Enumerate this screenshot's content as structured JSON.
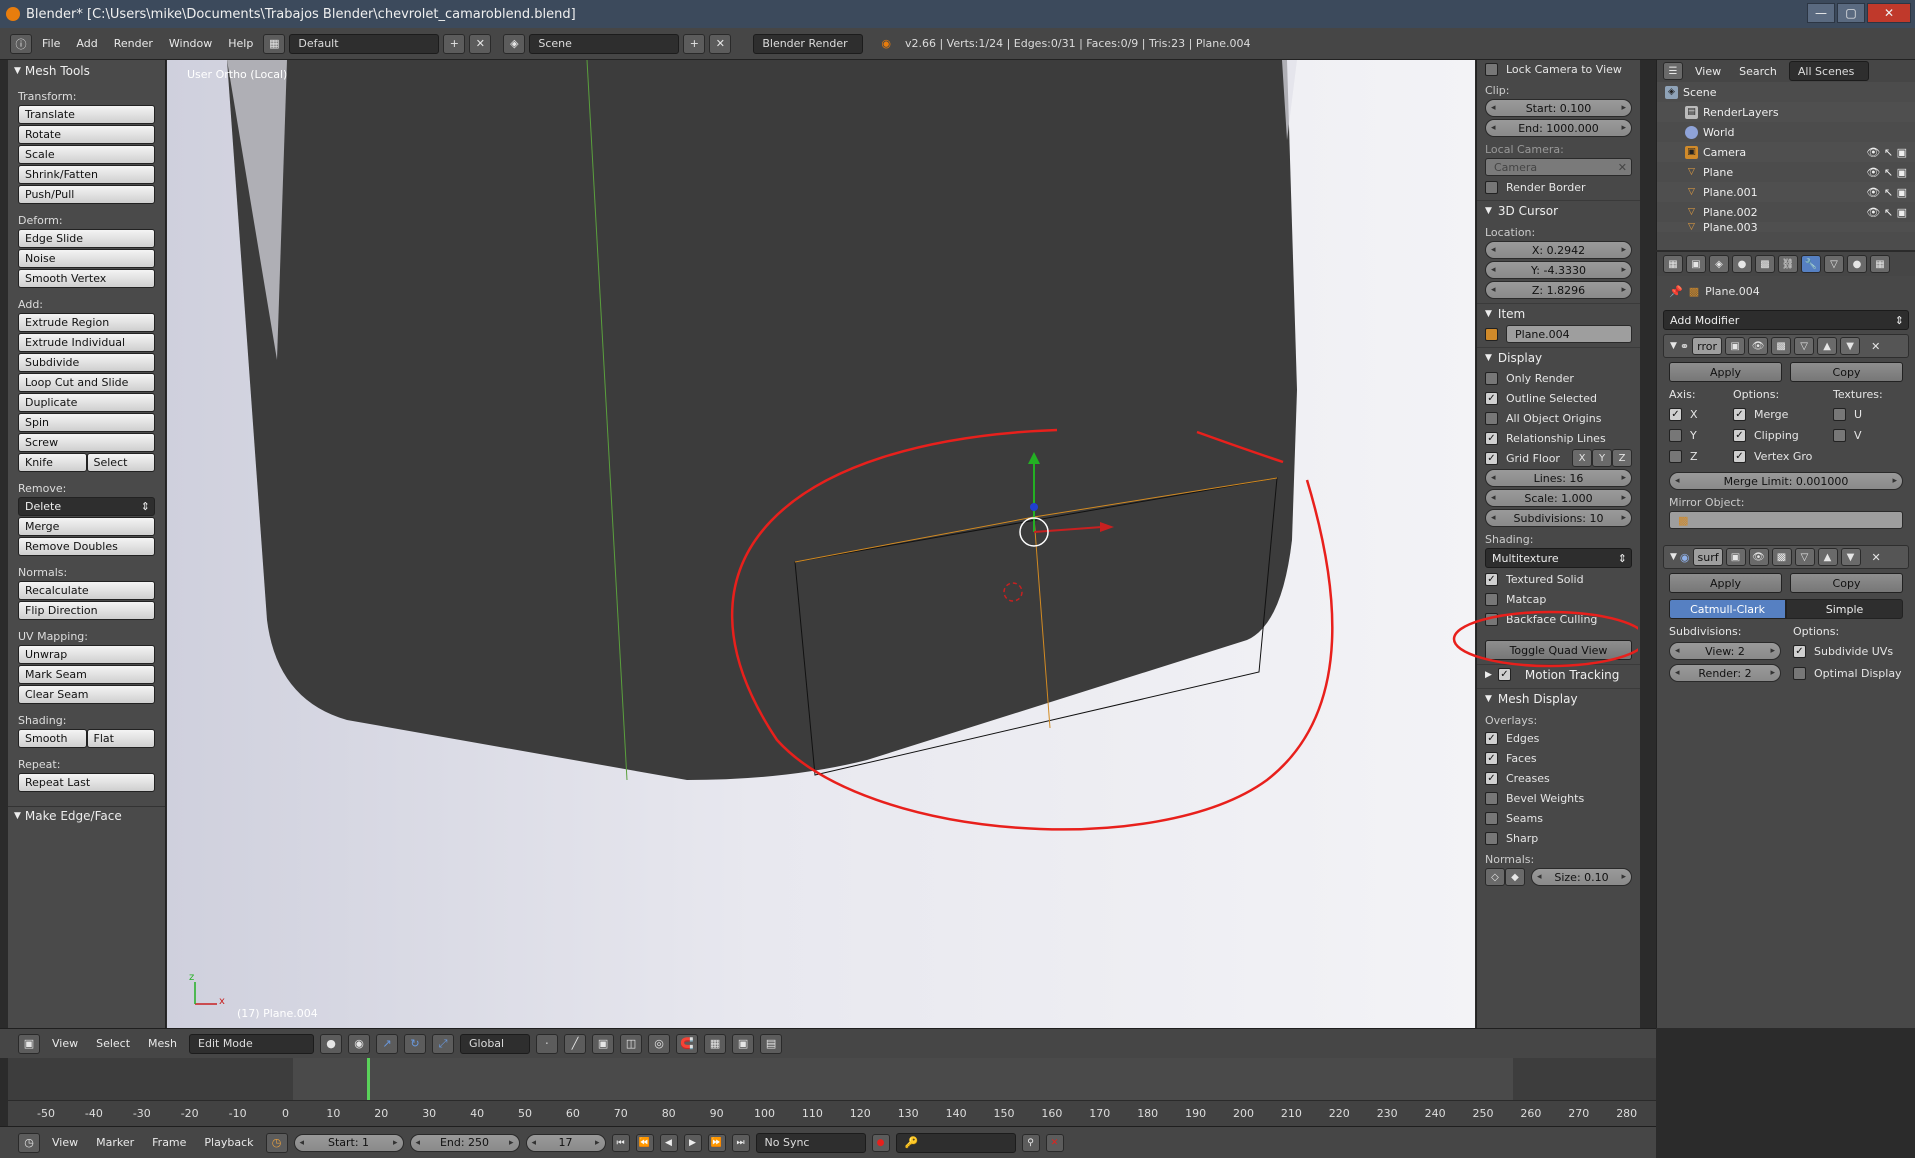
{
  "title": "Blender* [C:\\Users\\mike\\Documents\\Trabajos Blender\\chevrolet_camaroblend.blend]",
  "menus": [
    "File",
    "Add",
    "Render",
    "Window",
    "Help"
  ],
  "layout": "Default",
  "scene": "Scene",
  "engine": "Blender Render",
  "stats": "v2.66 | Verts:1/24 | Edges:0/31 | Faces:0/9 | Tris:23 | Plane.004",
  "tool_shelf": {
    "title": "Mesh Tools",
    "transform_label": "Transform:",
    "transform": [
      "Translate",
      "Rotate",
      "Scale",
      "Shrink/Fatten",
      "Push/Pull"
    ],
    "deform_label": "Deform:",
    "deform": [
      "Edge Slide",
      "Noise",
      "Smooth Vertex"
    ],
    "add_label": "Add:",
    "add": [
      "Extrude Region",
      "Extrude Individual",
      "Subdivide",
      "Loop Cut and Slide",
      "Duplicate",
      "Spin",
      "Screw"
    ],
    "knife": "Knife",
    "select": "Select",
    "remove_label": "Remove:",
    "delete": "Delete",
    "merge": "Merge",
    "remove_doubles": "Remove Doubles",
    "normals_label": "Normals:",
    "recalculate": "Recalculate",
    "flip": "Flip Direction",
    "uv_label": "UV Mapping:",
    "unwrap": "Unwrap",
    "mark_seam": "Mark Seam",
    "clear_seam": "Clear Seam",
    "shading_label": "Shading:",
    "smooth": "Smooth",
    "flat": "Flat",
    "repeat_label": "Repeat:",
    "repeat_last": "Repeat Last",
    "make_edge": "Make Edge/Face"
  },
  "viewport": {
    "view_label": "User Ortho (Local)",
    "object_label": "(17) Plane.004",
    "axis_x": "x",
    "axis_z": "z"
  },
  "nprops": {
    "lock_camera": "Lock Camera to View",
    "clip_label": "Clip:",
    "clip_start": "Start: 0.100",
    "clip_end": "End: 1000.000",
    "local_camera": "Local Camera:",
    "camera": "Camera",
    "render_border": "Render Border",
    "cursor_title": "3D Cursor",
    "location_label": "Location:",
    "cx": "X: 0.2942",
    "cy": "Y: -4.3330",
    "cz": "Z: 1.8296",
    "item_title": "Item",
    "item_name": "Plane.004",
    "display_title": "Display",
    "only_render": "Only Render",
    "outline_selected": "Outline Selected",
    "all_origins": "All Object Origins",
    "relationship": "Relationship Lines",
    "grid_floor": "Grid Floor",
    "gx": "X",
    "gy": "Y",
    "gz": "Z",
    "lines": "Lines: 16",
    "scale": "Scale: 1.000",
    "subdivisions": "Subdivisions: 10",
    "shading_label": "Shading:",
    "shading": "Multitexture",
    "textured_solid": "Textured Solid",
    "matcap": "Matcap",
    "backface": "Backface Culling",
    "toggle_quad": "Toggle Quad View",
    "motion_tracking": "Motion Tracking",
    "mesh_display": "Mesh Display",
    "overlays": "Overlays:",
    "edges": "Edges",
    "faces": "Faces",
    "creases": "Creases",
    "bevel": "Bevel Weights",
    "seams": "Seams",
    "sharp": "Sharp",
    "normals_label": "Normals:",
    "size": "Size: 0.10"
  },
  "outliner": {
    "view": "View",
    "search": "Search",
    "all_scenes": "All Scenes",
    "rows": [
      "Scene",
      "RenderLayers",
      "World",
      "Camera",
      "Plane",
      "Plane.001",
      "Plane.002",
      "Plane.003"
    ]
  },
  "props": {
    "object": "Plane.004",
    "add_modifier": "Add Modifier",
    "mirror_name": "rror",
    "apply": "Apply",
    "copy": "Copy",
    "axis": "Axis:",
    "options": "Options:",
    "textures": "Textures:",
    "x": "X",
    "y": "Y",
    "z": "Z",
    "merge": "Merge",
    "clipping": "Clipping",
    "vertex_gro": "Vertex Gro",
    "u": "U",
    "v": "V",
    "merge_limit": "Merge Limit: 0.001000",
    "mirror_object": "Mirror Object:",
    "surf_name": "surf",
    "catmull": "Catmull-Clark",
    "simple": "Simple",
    "subdivisions": "Subdivisions:",
    "options2": "Options:",
    "view_level": "View: 2",
    "render_level": "Render: 2",
    "subdiv_uvs": "Subdivide UVs",
    "optimal": "Optimal Display"
  },
  "header3d": {
    "view": "View",
    "select": "Select",
    "mesh": "Mesh",
    "mode": "Edit Mode",
    "orientation": "Global"
  },
  "timeline": {
    "view": "View",
    "marker": "Marker",
    "frame": "Frame",
    "playback": "Playback",
    "start": "Start: 1",
    "end": "End: 250",
    "current": "17",
    "sync": "No Sync",
    "ticks": [
      "-50",
      "-40",
      "-30",
      "-20",
      "-10",
      "0",
      "10",
      "20",
      "30",
      "40",
      "50",
      "60",
      "70",
      "80",
      "90",
      "100",
      "110",
      "120",
      "130",
      "140",
      "150",
      "160",
      "170",
      "180",
      "190",
      "200",
      "210",
      "220",
      "230",
      "240",
      "250",
      "260",
      "270",
      "280"
    ]
  },
  "colors": {
    "annotation": "#e8201c",
    "accent": "#5680c2"
  }
}
